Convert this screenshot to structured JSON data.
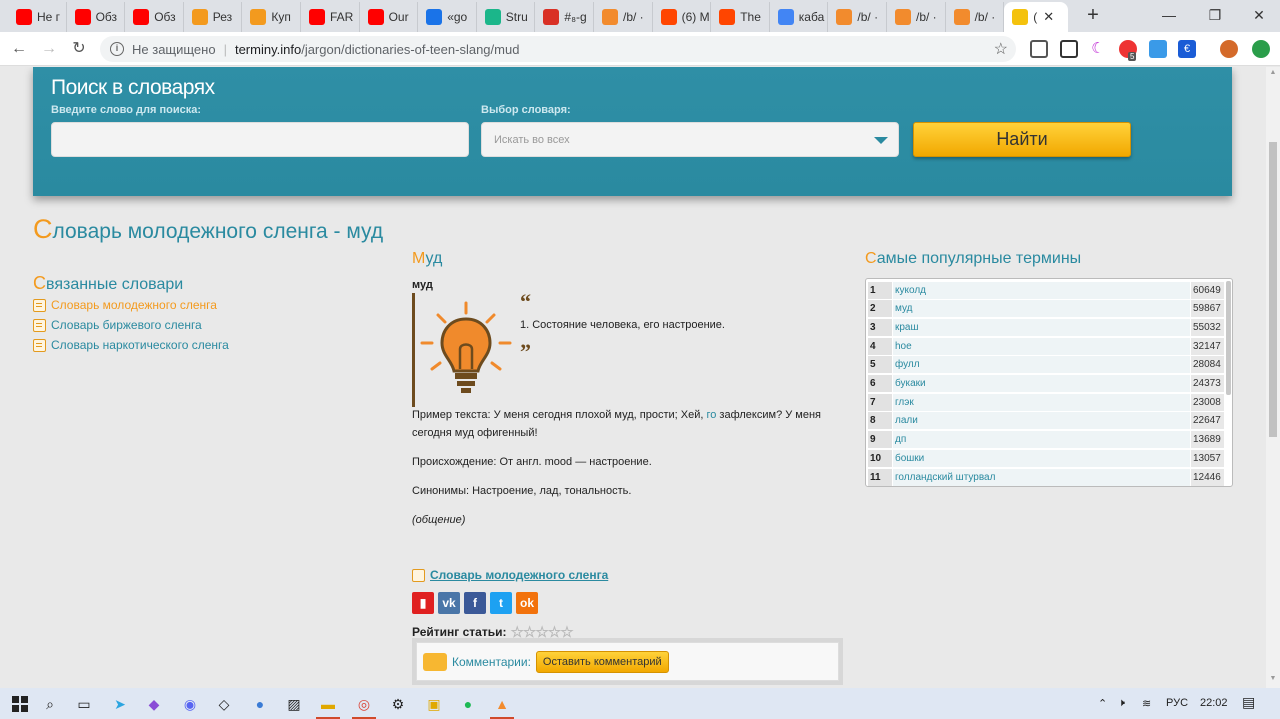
{
  "browser": {
    "tabs": [
      {
        "label": "Не г",
        "icon": "youtube-icon",
        "color": "#ff0000"
      },
      {
        "label": "Обз",
        "icon": "youtube-icon",
        "color": "#ff0000"
      },
      {
        "label": "Обз",
        "icon": "youtube-icon",
        "color": "#ff0000"
      },
      {
        "label": "Рез",
        "icon": "workflow-icon",
        "color": "#f39a1e"
      },
      {
        "label": "Куп",
        "icon": "workflow-icon",
        "color": "#f39a1e"
      },
      {
        "label": "FAR",
        "icon": "youtube-icon",
        "color": "#ff0000"
      },
      {
        "label": "Our",
        "icon": "youtube-icon",
        "color": "#ff0000"
      },
      {
        "label": "«go",
        "icon": "cart-icon",
        "color": "#1a73e8"
      },
      {
        "label": "Stru",
        "icon": "shield-icon",
        "color": "#1bb68a"
      },
      {
        "label": "#₈-g",
        "icon": "calendar-icon",
        "color": "#d93025"
      },
      {
        "label": "/b/ ·",
        "icon": "lightning-icon",
        "color": "#f28b2d"
      },
      {
        "label": "(6) M",
        "icon": "reddit-icon",
        "color": "#ff4500"
      },
      {
        "label": "The",
        "icon": "reddit-icon",
        "color": "#ff4500"
      },
      {
        "label": "каба",
        "icon": "google-icon",
        "color": "#4285f4"
      },
      {
        "label": "/b/ ·",
        "icon": "lightning-icon",
        "color": "#f28b2d"
      },
      {
        "label": "/b/ ·",
        "icon": "lightning-icon",
        "color": "#f28b2d"
      },
      {
        "label": "/b/ ·",
        "icon": "lightning-icon",
        "color": "#f28b2d"
      },
      {
        "label": "(",
        "icon": "pencil-icon",
        "color": "#f4c20d"
      }
    ],
    "window_controls": {
      "minimize": "—",
      "maximize": "❐",
      "close": "✕"
    },
    "address": {
      "security_label": "Не защищено",
      "separator": "|",
      "host": "terminy.info",
      "path": "/jargon/dictionaries-of-teen-slang/mud"
    },
    "extension_badge": "5"
  },
  "search": {
    "title": "Поиск в словарях",
    "query_label": "Введите слово для поиска:",
    "query_value": "",
    "dict_label": "Выбор словаря:",
    "dict_selected": "Искать во всех",
    "button_label": "Найти"
  },
  "page": {
    "title_first_letter": "С",
    "title_rest": "ловарь молодежного сленга - муд"
  },
  "sidebar": {
    "title_first_letter": "С",
    "title_rest": "вязанные словари",
    "links": [
      {
        "label": "Словарь молодежного сленга",
        "active": true
      },
      {
        "label": "Словарь биржевого сленга",
        "active": false
      },
      {
        "label": "Словарь наркотического сленга",
        "active": false
      }
    ]
  },
  "article": {
    "title_first_letter": "М",
    "title_rest": "уд",
    "word": "муд",
    "quote_open": "“",
    "quote_close": "”",
    "definition": "1. Состояние человека, его настроение.",
    "example_a": "Пример текста: У меня сегодня плохой муд, прости; Хей, ",
    "example_link": "го",
    "example_b": " зафлексим? У меня сегодня муд офигенный!",
    "origin": "Происхождение: От англ. mood — настроение.",
    "synonyms": "Синонимы: Настроение, лад, тональность.",
    "category": "(общение)",
    "dict_link": "Словарь молодежного сленга",
    "rating_label": "Рейтинг статьи:",
    "rating_stars": "☆☆☆☆☆",
    "rating_value": 0,
    "comments_label": "Комментарии:",
    "comments_button": "Оставить комментарий",
    "share_buttons": [
      {
        "icon": "bookmark-icon",
        "glyph": "▮",
        "color": "#e02020"
      },
      {
        "icon": "vk-icon",
        "glyph": "vk",
        "color": "#4a76a8"
      },
      {
        "icon": "facebook-icon",
        "glyph": "f",
        "color": "#3b5998"
      },
      {
        "icon": "twitter-icon",
        "glyph": "t",
        "color": "#1da1f2"
      },
      {
        "icon": "odnoklassniki-icon",
        "glyph": "ok",
        "color": "#f2720c"
      }
    ]
  },
  "popular": {
    "title_first_letter": "С",
    "title_rest": "амые популярные термины",
    "rows": [
      {
        "n": "1",
        "term": "куколд",
        "count": "60649"
      },
      {
        "n": "2",
        "term": "муд",
        "count": "59867"
      },
      {
        "n": "3",
        "term": "краш",
        "count": "55032"
      },
      {
        "n": "4",
        "term": "hoe",
        "count": "32147"
      },
      {
        "n": "5",
        "term": "фулл",
        "count": "28084"
      },
      {
        "n": "6",
        "term": "букаки",
        "count": "24373"
      },
      {
        "n": "7",
        "term": "глэк",
        "count": "23008"
      },
      {
        "n": "8",
        "term": "лали",
        "count": "22647"
      },
      {
        "n": "9",
        "term": "дп",
        "count": "13689"
      },
      {
        "n": "10",
        "term": "бошки",
        "count": "13057"
      },
      {
        "n": "11",
        "term": "голландский штурвал",
        "count": "12446"
      }
    ]
  },
  "taskbar": {
    "tray_lang": "РУС",
    "tray_time": "22:02"
  },
  "colors": {
    "accent_teal": "#2a8aa0",
    "accent_orange": "#f39a1e",
    "button_yellow": "#f2a800"
  }
}
